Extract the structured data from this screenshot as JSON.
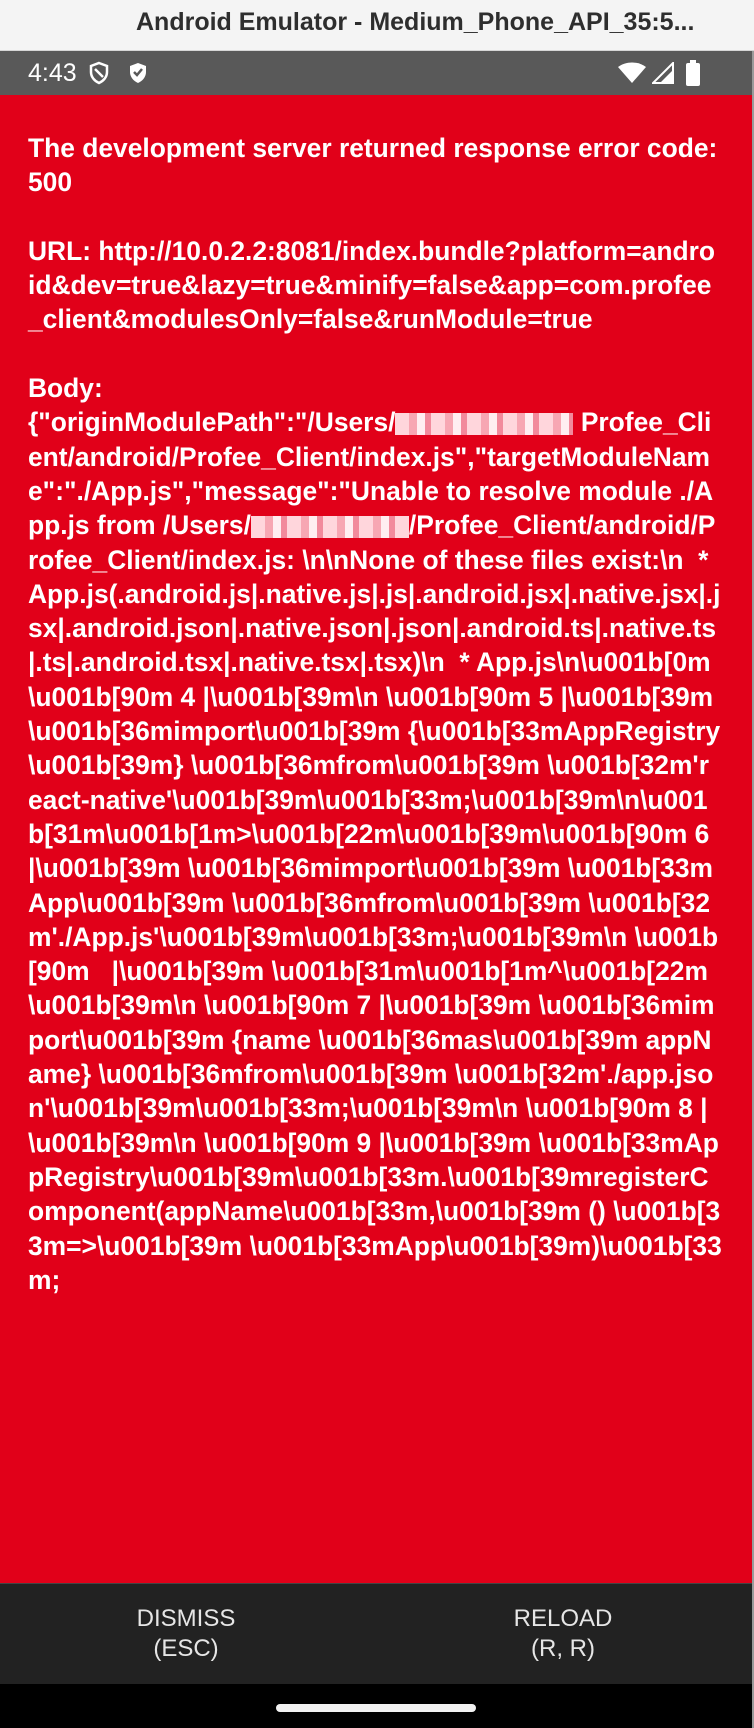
{
  "window": {
    "title": "Android Emulator - Medium_Phone_API_35:5..."
  },
  "status_bar": {
    "time": "4:43",
    "left_icons": [
      "shield-outline-icon",
      "shield-filled-icon"
    ],
    "right_icons": [
      "wifi-icon",
      "cellular-signal-icon",
      "battery-icon"
    ]
  },
  "error": {
    "heading": "The development server returned response error code: 500",
    "url_line": "URL: http://10.0.2.2:8081/index.bundle?platform=android&dev=true&lazy=true&minify=false&app=com.profee_client&modulesOnly=false&runModule=true",
    "body_label": "Body:",
    "body_part1": "{\"originModulePath\":\"/Users/",
    "body_part2": "Profee_Client/android/Profee_Client/index.js\",\"targetModuleName\":\"./App.js\",\"message\":\"Unable to resolve module ./App.js from /Users/",
    "body_part3": "/Profee_Client/android/Profee_Client/index.js: \\n\\nNone of these files exist:\\n  * App.js(.android.js|.native.js|.js|.android.jsx|.native.jsx|.jsx|.android.json|.native.json|.json|.android.ts|.native.ts|.ts|.android.tsx|.native.tsx|.tsx)\\n  * App.js\\n\\u001b[0m \\u001b[90m 4 |\\u001b[39m\\n \\u001b[90m 5 |\\u001b[39m \\u001b[36mimport\\u001b[39m {\\u001b[33mAppRegistry\\u001b[39m} \\u001b[36mfrom\\u001b[39m \\u001b[32m'react-native'\\u001b[39m\\u001b[33m;\\u001b[39m\\n\\u001b[31m\\u001b[1m>\\u001b[22m\\u001b[39m\\u001b[90m 6 |\\u001b[39m \\u001b[36mimport\\u001b[39m \\u001b[33mApp\\u001b[39m \\u001b[36mfrom\\u001b[39m \\u001b[32m'./App.js'\\u001b[39m\\u001b[33m;\\u001b[39m\\n \\u001b[90m   |\\u001b[39m \\u001b[31m\\u001b[1m^\\u001b[22m\\u001b[39m\\n \\u001b[90m 7 |\\u001b[39m \\u001b[36mimport\\u001b[39m {name \\u001b[36mas\\u001b[39m appName} \\u001b[36mfrom\\u001b[39m \\u001b[32m'./app.json'\\u001b[39m\\u001b[33m;\\u001b[39m\\n \\u001b[90m 8 |\\u001b[39m\\n \\u001b[90m 9 |\\u001b[39m \\u001b[33mAppRegistry\\u001b[39m\\u001b[33m.\\u001b[39mregisterComponent(appName\\u001b[33m,\\u001b[39m () \\u001b[33m=>\\u001b[39m \\u001b[33mApp\\u001b[39m)\\u001b[33m;"
  },
  "actions": {
    "dismiss_label": "DISMISS",
    "dismiss_shortcut": "(ESC)",
    "reload_label": "RELOAD",
    "reload_shortcut": "(R, R)"
  },
  "colors": {
    "error_background": "#e10019",
    "status_bar": "#595959",
    "button_bar": "#222222"
  }
}
